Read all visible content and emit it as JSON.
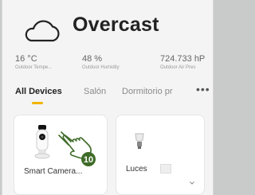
{
  "weather": {
    "condition": "Overcast",
    "stats": [
      {
        "value": "16 °C",
        "label": "Outdoor Tempe..."
      },
      {
        "value": "48 %",
        "label": "Outdoor Humidity"
      },
      {
        "value": "724.733 hP",
        "label": "Outdoor Air Pres"
      }
    ]
  },
  "tabs": [
    "All Devices",
    "Salón",
    "Dormitorio pr"
  ],
  "more_label": "•••",
  "devices": [
    {
      "name": "Smart Camera...",
      "icon": "camera-icon"
    },
    {
      "name": "Luces",
      "icon": "bulb-icon"
    }
  ],
  "annotation": {
    "step": "10"
  },
  "colors": {
    "accent": "#f0b400",
    "step_badge": "#3f6b28"
  }
}
